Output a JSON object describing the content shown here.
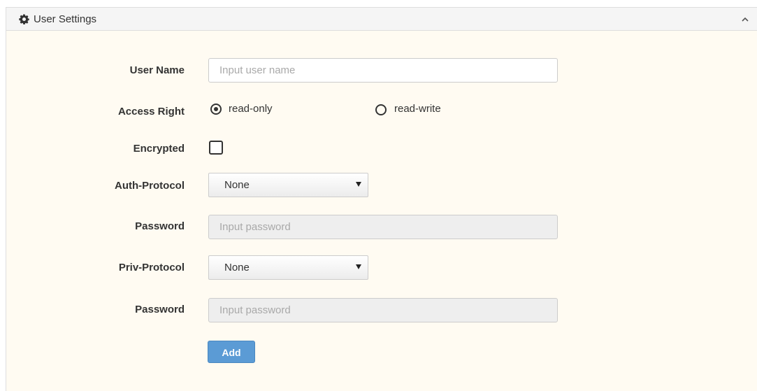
{
  "panel": {
    "title": "User Settings",
    "header_icon": "gear-icon",
    "collapse_icon": "chevron-up-icon"
  },
  "form": {
    "user_name": {
      "label": "User Name",
      "placeholder": "Input user name",
      "value": ""
    },
    "access_right": {
      "label": "Access Right",
      "options": [
        "read-only",
        "read-write"
      ],
      "selected": "read-only"
    },
    "encrypted": {
      "label": "Encrypted",
      "checked": false
    },
    "auth_protocol": {
      "label": "Auth-Protocol",
      "selected": "None"
    },
    "auth_password": {
      "label": "Password",
      "placeholder": "Input password",
      "value": ""
    },
    "priv_protocol": {
      "label": "Priv-Protocol",
      "selected": "None"
    },
    "priv_password": {
      "label": "Password",
      "placeholder": "Input password",
      "value": ""
    },
    "add_label": "Add"
  },
  "colors": {
    "panel_background": "#fffbf2",
    "header_background": "#f5f5f5",
    "button_primary": "#5b9bd5"
  }
}
